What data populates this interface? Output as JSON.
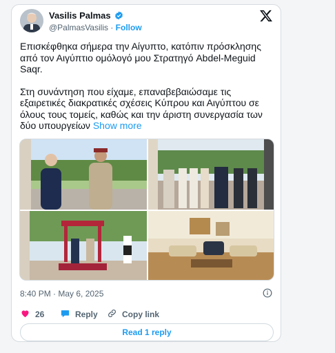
{
  "author": {
    "name": "Vasilis Palmas",
    "handle": "@PalmasVasilis",
    "separator": "·",
    "follow_label": "Follow"
  },
  "post": {
    "paragraph1": "Επισκέφθηκα σήμερα την Αίγυπτο, κατόπιν πρόσκλησης από τον Αιγύπτιο ομόλογό μου Στρατηγό Abdel-Meguid Saqr.",
    "paragraph2": "Στη συνάντηση που είχαμε, επαναβεβαιώσαμε τις εξαιρετικές διακρατικές σχέσεις Κύπρου και Αιγύπτου σε όλους τους τομείς, καθώς και την άριστη συνεργασία των δύο υπουργείων",
    "show_more": "Show more"
  },
  "timestamp": "8:40 PM · May 6, 2025",
  "actions": {
    "likes": "26",
    "reply_label": "Reply",
    "copy_link_label": "Copy link"
  },
  "read_replies_label": "Read 1 reply",
  "colors": {
    "accent": "#1d9bf0",
    "like": "#f91880",
    "muted": "#536471"
  },
  "icons": [
    "verified-badge-icon",
    "x-logo-icon",
    "info-icon",
    "heart-icon",
    "reply-icon",
    "link-icon"
  ]
}
